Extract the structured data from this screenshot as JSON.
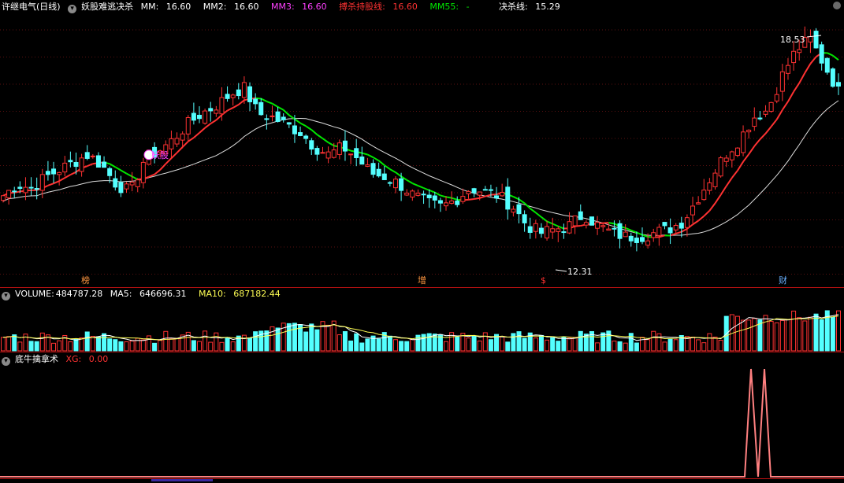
{
  "main_panel": {
    "stock_name": "许继电气(日线)",
    "indicator_name": "妖股难逃决杀",
    "mm_label": "MM:",
    "mm_value": "16.60",
    "mm2_label": "MM2:",
    "mm2_value": "16.60",
    "mm3_label": "MM3:",
    "mm3_value": "16.60",
    "bojie_label": "搏杀持股线:",
    "bojie_value": "16.60",
    "mm55_label": "MM55:",
    "mm55_value": "-",
    "juesha_label": "决杀线:",
    "juesha_value": "15.29",
    "high_label": "18.53",
    "low_label": "12.31",
    "signal_label": "妖股",
    "markers": [
      "榜",
      "增",
      "$",
      "财"
    ]
  },
  "volume_panel": {
    "title": "VOLUME:",
    "value": "484787.28",
    "ma5_label": "MA5:",
    "ma5_value": "646696.31",
    "ma10_label": "MA10:",
    "ma10_value": "687182.44"
  },
  "xg_panel": {
    "title": "底牛擒拿术",
    "xg_label": "XG:",
    "xg_value": "0.00"
  },
  "colors": {
    "up": "#ff3232",
    "down": "#54ffff",
    "green_line": "#00e600",
    "white_line": "#dcdcdc",
    "magenta": "#ff40ff",
    "yellow": "#ffff54",
    "panel_sep": "#b01010",
    "xg_line": "#ff8080"
  },
  "chart_data": {
    "type": "candlestick",
    "price_max": 18.53,
    "price_min": 12.31,
    "close_series": [
      14.3,
      14.6,
      14.5,
      14.8,
      15.0,
      15.2,
      15.4,
      15.1,
      14.6,
      14.4,
      15.3,
      15.5,
      15.8,
      16.2,
      16.5,
      16.7,
      17.0,
      17.2,
      16.5,
      16.4,
      16.2,
      16.0,
      15.6,
      15.4,
      15.6,
      15.3,
      14.9,
      14.8,
      14.6,
      14.3,
      14.1,
      14.0,
      14.2,
      14.5,
      14.4,
      14.3,
      14.0,
      13.5,
      13.3,
      13.4,
      13.5,
      13.8,
      13.5,
      13.3,
      13.2,
      13.2,
      13.3,
      13.4,
      13.6,
      14.2,
      14.8,
      15.4,
      15.8,
      16.4,
      16.6,
      17.5,
      18.2,
      18.5,
      17.8,
      17.1
    ],
    "volume_max": 1700000
  }
}
